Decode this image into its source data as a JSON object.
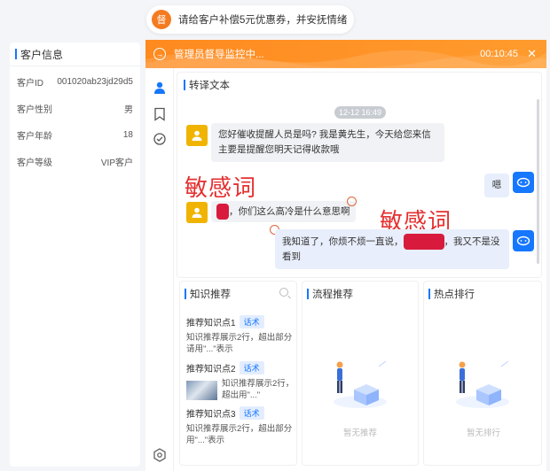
{
  "notice": {
    "badge": "督",
    "text": "请给客户补偿5元优惠券，并安抚情绪"
  },
  "customer": {
    "title": "客户信息",
    "rows": [
      {
        "label": "客户ID",
        "value": "001020ab23jd29d5"
      },
      {
        "label": "客户性别",
        "value": "男"
      },
      {
        "label": "客户年龄",
        "value": "18"
      },
      {
        "label": "客户等级",
        "value": "VIP客户"
      }
    ]
  },
  "header": {
    "label": "管理员督导监控中...",
    "time": "00:10:45",
    "close": "✕"
  },
  "transcript": {
    "title": "转译文本",
    "timestamp": "12-12 16:49",
    "messages": [
      {
        "side": "left",
        "text": "您好催收提醒人员是吗? 我是黄先生，今天给您来信主要是提醒您明天记得收款哦"
      },
      {
        "side": "right",
        "text": "嗯"
      },
      {
        "side": "left",
        "text_after": "，你们这么高冷是什么意思啊"
      },
      {
        "side": "right",
        "text_before": "我知道了，你烦不烦一直说，",
        "text_after": "，我又不是没看到"
      }
    ],
    "sensitive_label_1": "敏感词",
    "sensitive_label_2": "敏感词"
  },
  "knowledge": {
    "title": "知识推荐",
    "items": [
      {
        "title": "推荐知识点1",
        "tag": "话术",
        "desc": "知识推荐展示2行，超出部分请用\"...\"表示"
      },
      {
        "title": "推荐知识点2",
        "tag": "话术",
        "desc": "知识推荐展示2行，超出用\"...\""
      },
      {
        "title": "推荐知识点3",
        "tag": "话术",
        "desc": "知识推荐展示2行，超出部分用\"...\"表示"
      }
    ]
  },
  "process": {
    "title": "流程推荐",
    "empty": "暂无推荐"
  },
  "hot": {
    "title": "热点排行",
    "empty": "暂无排行"
  },
  "colors": {
    "accent": "#1677ff",
    "orange": "#ff8a1f",
    "sensitive": "#e53030",
    "mask": "#d81b3c"
  },
  "icons": [
    "user-icon",
    "bookmark-icon",
    "headset-icon",
    "settings-icon",
    "search-icon",
    "bot-icon",
    "smile-icon"
  ]
}
